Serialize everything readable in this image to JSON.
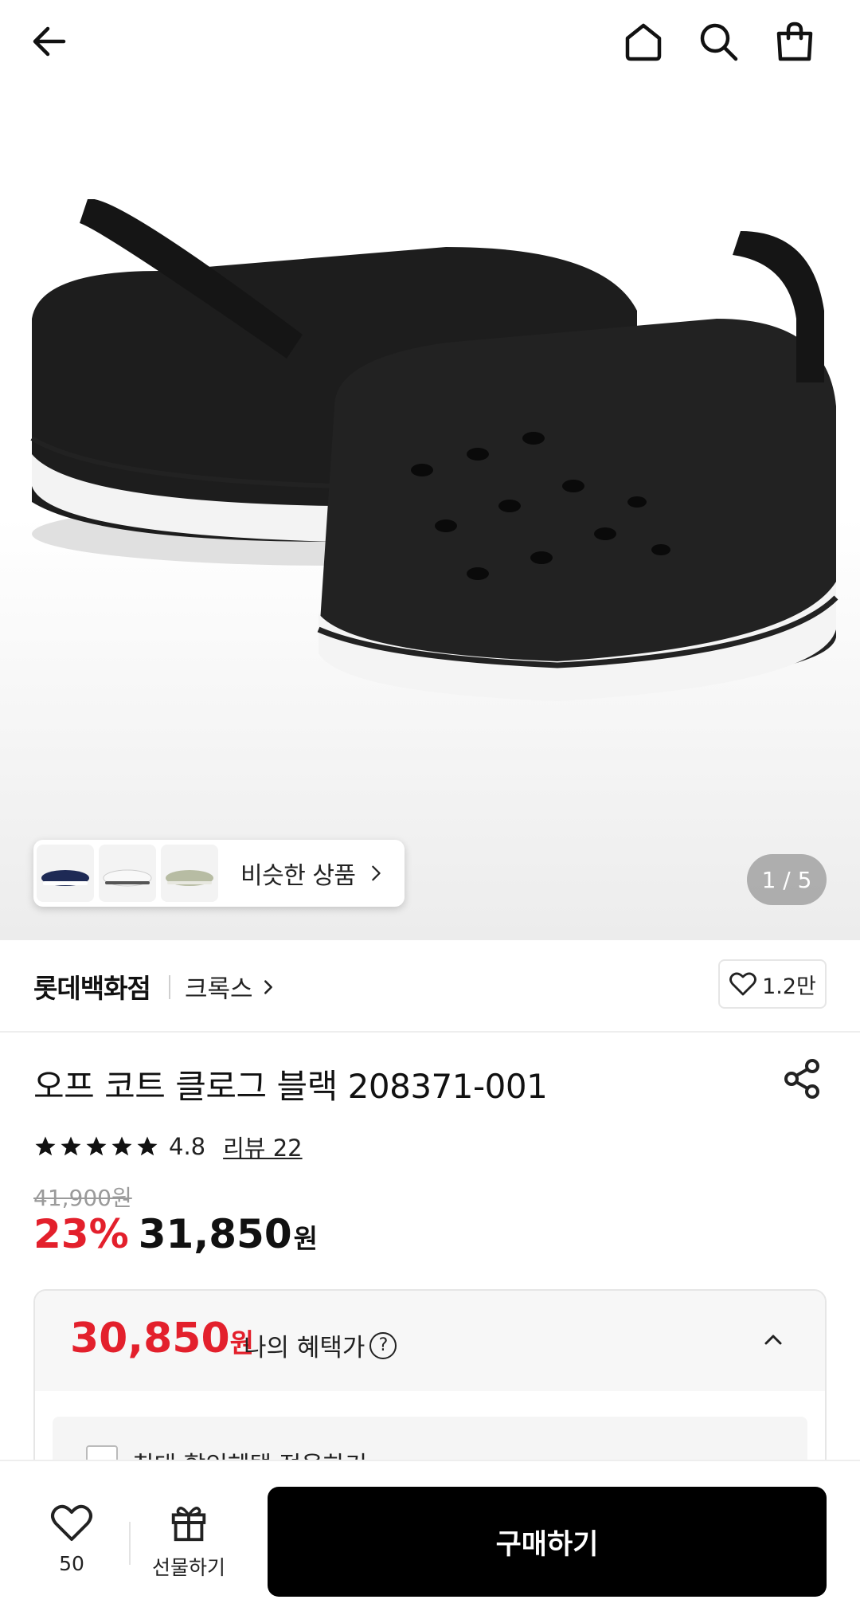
{
  "header": {
    "back_icon": "arrow-left-icon",
    "home_icon": "home-icon",
    "search_icon": "search-icon",
    "cart_icon": "shopping-bag-icon"
  },
  "gallery": {
    "similar_label": "비슷한 상품",
    "pager": "1 / 5"
  },
  "seller": {
    "store": "롯데백화점",
    "brand": "크록스",
    "likes": "1.2만"
  },
  "product": {
    "title": "오프 코트 클로그 블랙 208371-001",
    "rating": "4.8",
    "review_link": "리뷰 22",
    "original_price": "41,900원",
    "discount": "23%",
    "price": "31,850",
    "price_unit": "원"
  },
  "benefit": {
    "price": "30,850",
    "price_unit": "원",
    "label": "나의 혜택가",
    "help_symbol": "?",
    "max_discount_label": "최대 할인혜택 적용하기"
  },
  "bottom_bar": {
    "wish_count": "50",
    "gift_label": "선물하기",
    "buy_label": "구매하기"
  },
  "colors": {
    "accent_red": "#e3202c",
    "buy_button": "#000000"
  }
}
